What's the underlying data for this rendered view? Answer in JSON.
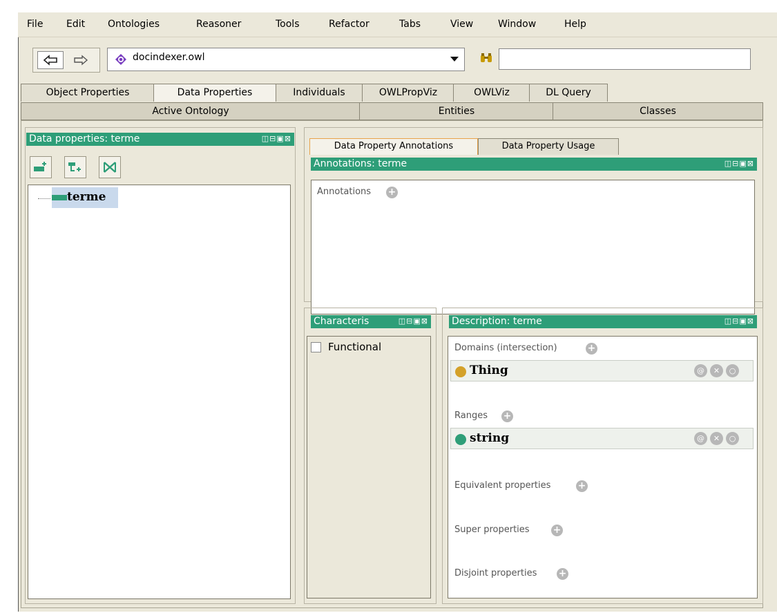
{
  "menu": [
    "File",
    "Edit",
    "Ontologies",
    "Reasoner",
    "Tools",
    "Refactor",
    "Tabs",
    "View",
    "Window",
    "Help"
  ],
  "toolbar": {
    "back_icon": "arrow-left-icon",
    "forward_icon": "arrow-right-icon",
    "ontology_name": "docindexer.owl",
    "dropdown_icon": "chevron-down-icon",
    "search_icon": "binoculars-icon",
    "search_value": ""
  },
  "tabs_row1": [
    "Object Properties",
    "Data Properties",
    "Individuals",
    "OWLPropViz",
    "OWLViz",
    "DL Query"
  ],
  "tabs_row2": [
    "Active Ontology",
    "Entities",
    "Classes"
  ],
  "left_panel": {
    "title": "Data properties: terme",
    "tree_items": [
      "terme"
    ]
  },
  "annotation_tabs": [
    "Data Property Annotations",
    "Data Property Usage"
  ],
  "annotations_view": {
    "title": "Annotations: terme",
    "section_label": "Annotations"
  },
  "characteristics_view": {
    "title": "Characteris",
    "items": [
      {
        "label": "Functional",
        "checked": false
      }
    ]
  },
  "description_view": {
    "title": "Description: terme",
    "domains_label": "Domains (intersection)",
    "domain_value": "Thing",
    "ranges_label": "Ranges",
    "range_value": "string",
    "equivalent_label": "Equivalent properties",
    "super_label": "Super properties",
    "disjoint_label": "Disjoint properties"
  },
  "colors": {
    "view_header": "#2e9e78",
    "thing_dot": "#d4a12a",
    "string_dot": "#2e9e78",
    "selection": "#c9d9ec"
  }
}
